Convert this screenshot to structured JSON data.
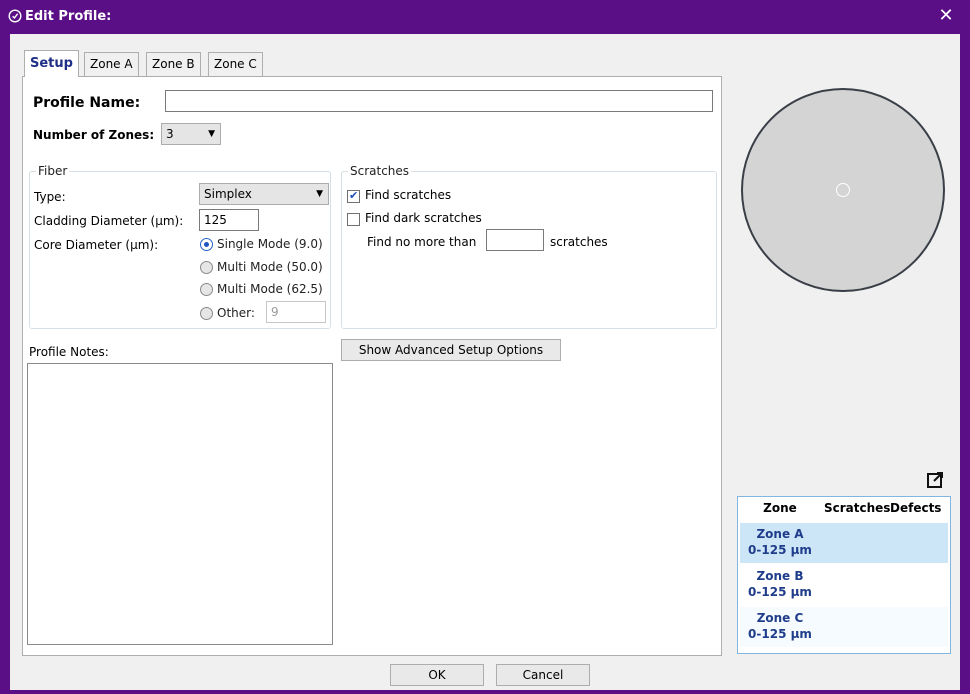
{
  "window": {
    "title": "Edit Profile:",
    "close_glyph": "✕"
  },
  "tabs": [
    {
      "label": "Setup",
      "active": true
    },
    {
      "label": "Zone A",
      "active": false
    },
    {
      "label": "Zone B",
      "active": false
    },
    {
      "label": "Zone C",
      "active": false
    }
  ],
  "profile": {
    "name_label": "Profile Name:",
    "name_value": "",
    "zones_label": "Number of Zones:",
    "zones_value": "3"
  },
  "fiber": {
    "title": "Fiber",
    "type_label": "Type:",
    "type_value": "Simplex",
    "cladding_label": "Cladding Diameter (µm):",
    "cladding_value": "125",
    "core_label": "Core Diameter (µm):",
    "core_options": [
      {
        "label": "Single Mode (9.0)",
        "selected": true
      },
      {
        "label": "Multi Mode (50.0)",
        "selected": false
      },
      {
        "label": "Multi Mode (62.5)",
        "selected": false
      },
      {
        "label": "Other:",
        "selected": false
      }
    ],
    "other_value": "9"
  },
  "scratches": {
    "title": "Scratches",
    "find_label": "Find scratches",
    "find_checked": true,
    "find_dark_label": "Find dark scratches",
    "find_dark_checked": false,
    "limit_prefix": "Find no more than",
    "limit_value": "",
    "limit_suffix": "scratches"
  },
  "advanced_button": "Show Advanced Setup Options",
  "notes_label": "Profile Notes:",
  "notes_value": "",
  "zones_table": {
    "headers": [
      "Zone",
      "Scratches",
      "Defects"
    ],
    "rows": [
      {
        "zone": "Zone A",
        "range": "0-125 µm",
        "scratches": "",
        "defects": ""
      },
      {
        "zone": "Zone B",
        "range": "0-125 µm",
        "scratches": "",
        "defects": ""
      },
      {
        "zone": "Zone C",
        "range": "0-125 µm",
        "scratches": "",
        "defects": ""
      }
    ]
  },
  "footer": {
    "ok": "OK",
    "cancel": "Cancel"
  },
  "colors": {
    "titlebar": "#5a0f86",
    "accent": "#1f3d8a",
    "selected_row": "#cde6f7"
  }
}
